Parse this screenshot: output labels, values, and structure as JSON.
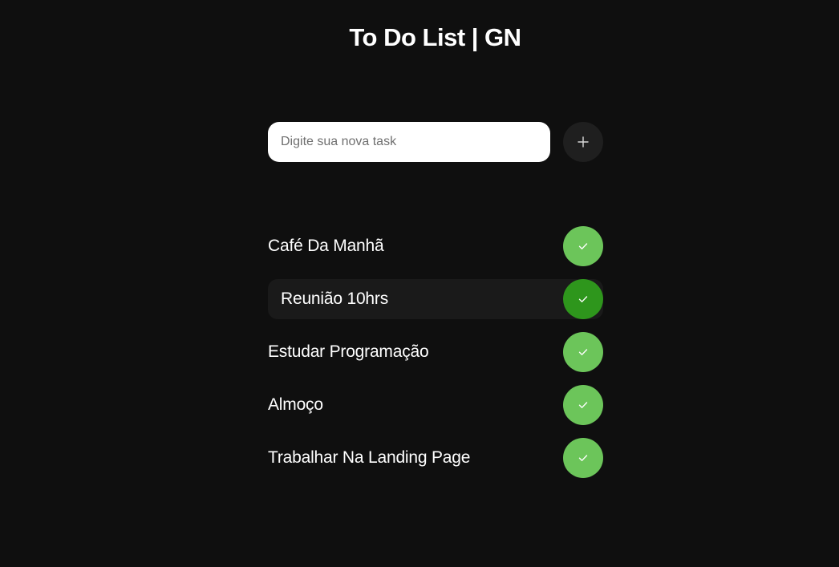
{
  "header": {
    "title": "To Do List | GN"
  },
  "new_task": {
    "placeholder": "Digite sua nova task",
    "value": "",
    "add_icon": "plus-icon"
  },
  "tasks": [
    {
      "label": "Café Da Manhã",
      "icon": "check-icon",
      "hovered": false
    },
    {
      "label": "Reunião 10hrs",
      "icon": "check-icon",
      "hovered": true
    },
    {
      "label": "Estudar Programação",
      "icon": "check-icon",
      "hovered": false
    },
    {
      "label": "Almoço",
      "icon": "check-icon",
      "hovered": false
    },
    {
      "label": "Trabalhar Na Landing Page",
      "icon": "check-icon",
      "hovered": false
    }
  ],
  "colors": {
    "background": "#0f0f0f",
    "check": "#6cc55a",
    "check_hover": "#2e961c",
    "add_button": "#1f1f1f",
    "row_hover": "#1a1a1a"
  }
}
